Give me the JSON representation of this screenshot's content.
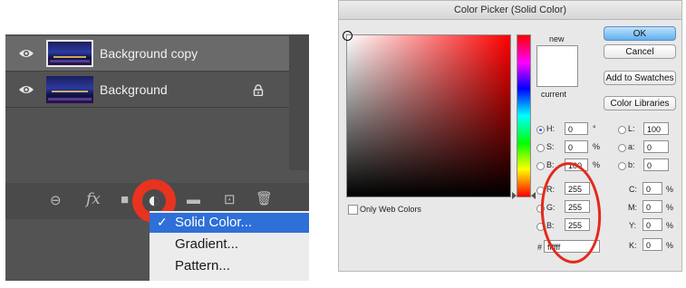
{
  "layers_panel": {
    "layers": [
      {
        "name": "Background copy",
        "selected": true
      },
      {
        "name": "Background",
        "locked": true
      }
    ],
    "tools": [
      {
        "name": "link",
        "glyph": "⊖"
      },
      {
        "name": "fx",
        "glyph": "fx"
      },
      {
        "name": "mask",
        "glyph": "■"
      },
      {
        "name": "adjustment",
        "glyph": "◐"
      },
      {
        "name": "group",
        "glyph": "▬"
      },
      {
        "name": "new-layer",
        "glyph": "⊡"
      },
      {
        "name": "delete",
        "glyph": "🗑"
      }
    ],
    "menu": {
      "items": [
        {
          "label": "Solid Color...",
          "selected": true
        },
        {
          "label": "Gradient..."
        },
        {
          "label": "Pattern..."
        }
      ],
      "check": "✓"
    }
  },
  "color_picker": {
    "title": "Color Picker (Solid Color)",
    "new_label": "new",
    "current_label": "current",
    "buttons": {
      "ok": "OK",
      "cancel": "Cancel",
      "add_to_swatches": "Add to Swatches",
      "color_libraries": "Color Libraries"
    },
    "only_web_colors": "Only Web Colors",
    "hsb": [
      {
        "label": "H:",
        "value": "0",
        "unit": "°",
        "selected": true
      },
      {
        "label": "S:",
        "value": "0",
        "unit": "%"
      },
      {
        "label": "B:",
        "value": "100",
        "unit": "%"
      }
    ],
    "rgb": [
      {
        "label": "R:",
        "value": "255"
      },
      {
        "label": "G:",
        "value": "255"
      },
      {
        "label": "B:",
        "value": "255"
      }
    ],
    "lab": [
      {
        "label": "L:",
        "value": "100"
      },
      {
        "label": "a:",
        "value": "0"
      },
      {
        "label": "b:",
        "value": "0"
      }
    ],
    "cmyk": [
      {
        "label": "C:",
        "value": "0",
        "unit": "%"
      },
      {
        "label": "M:",
        "value": "0",
        "unit": "%"
      },
      {
        "label": "Y:",
        "value": "0",
        "unit": "%"
      },
      {
        "label": "K:",
        "value": "0",
        "unit": "%"
      }
    ],
    "hex_label": "#",
    "hex_value": "ffffff",
    "colors": {
      "new": "#ffffff",
      "current": "#ffffff",
      "annotation": "#e22a1c"
    }
  }
}
